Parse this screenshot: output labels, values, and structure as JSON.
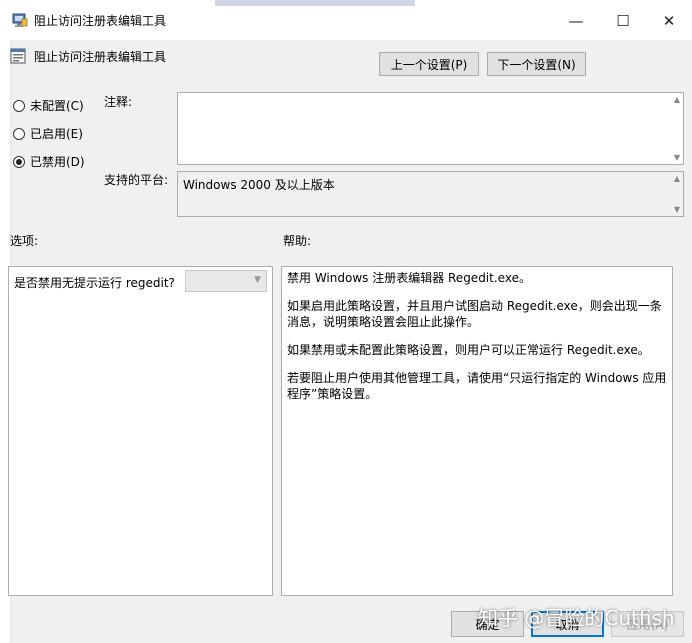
{
  "window": {
    "title": "阻止访问注册表编辑工具",
    "minimize_glyph": "—",
    "maximize_glyph": "☐",
    "close_glyph": "✕"
  },
  "header": {
    "policy_name": "阻止访问注册表编辑工具",
    "prev_button": "上一个设置(P)",
    "next_button": "下一个设置(N)"
  },
  "state_options": [
    {
      "label": "未配置(C)",
      "checked": false
    },
    {
      "label": "已启用(E)",
      "checked": false
    },
    {
      "label": "已禁用(D)",
      "checked": true
    }
  ],
  "comment": {
    "label": "注释:",
    "value": ""
  },
  "platform": {
    "label": "支持的平台:",
    "value": "Windows 2000 及以上版本"
  },
  "options_section": {
    "label": "选项:",
    "setting_label": "是否禁用无提示运行 regedit?",
    "dropdown_value": ""
  },
  "help_section": {
    "label": "帮助:",
    "paragraphs": [
      "禁用 Windows 注册表编辑器 Regedit.exe。",
      "如果启用此策略设置，并且用户试图启动 Regedit.exe，则会出现一条消息，说明策略设置会阻止此操作。",
      "如果禁用或未配置此策略设置，则用户可以正常运行 Regedit.exe。",
      "若要阻止用户使用其他管理工具，请使用“只运行指定的 Windows 应用程序”策略设置。"
    ]
  },
  "footer": {
    "ok_button": "确定",
    "cancel_button": "取消",
    "apply_button": "应用(A)"
  },
  "watermark": "知乎 @冒险的Cutfish"
}
